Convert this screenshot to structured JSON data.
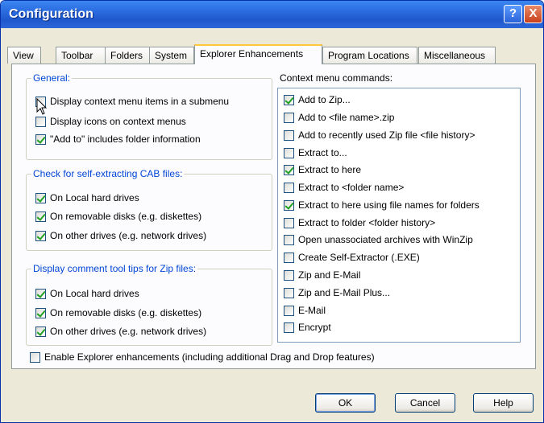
{
  "window": {
    "title": "Configuration"
  },
  "titlebar": {
    "help_glyph": "?",
    "close_glyph": "X"
  },
  "tabs": [
    {
      "label": "View"
    },
    {
      "label": "Toolbar"
    },
    {
      "label": "Folders"
    },
    {
      "label": "System"
    },
    {
      "label": "Explorer Enhancements"
    },
    {
      "label": "Program Locations"
    },
    {
      "label": "Miscellaneous"
    }
  ],
  "general": {
    "legend": "General:",
    "items": [
      {
        "label": "Display context menu items in a submenu",
        "checked": false
      },
      {
        "label": "Display icons on context menus",
        "checked": false
      },
      {
        "label": "\"Add to\" includes folder information",
        "checked": true
      }
    ]
  },
  "cab": {
    "legend": "Check for self-extracting CAB files:",
    "items": [
      {
        "label": "On Local hard drives",
        "checked": true
      },
      {
        "label": "On removable disks (e.g. diskettes)",
        "checked": true
      },
      {
        "label": "On other drives (e.g. network drives)",
        "checked": true
      }
    ]
  },
  "tooltips": {
    "legend": "Display comment tool tips for Zip files:",
    "items": [
      {
        "label": "On Local hard drives",
        "checked": true
      },
      {
        "label": "On removable disks (e.g. diskettes)",
        "checked": true
      },
      {
        "label": "On other drives (e.g. network drives)",
        "checked": true
      }
    ]
  },
  "context_menu": {
    "title": "Context menu commands:",
    "items": [
      {
        "label": "Add to Zip...",
        "checked": true
      },
      {
        "label": "Add to <file name>.zip",
        "checked": false
      },
      {
        "label": "Add to recently used Zip file <file history>",
        "checked": false
      },
      {
        "label": "Extract to...",
        "checked": false
      },
      {
        "label": "Extract to here",
        "checked": true
      },
      {
        "label": "Extract to <folder name>",
        "checked": false
      },
      {
        "label": "Extract to here using file names for folders",
        "checked": true
      },
      {
        "label": "Extract to folder <folder history>",
        "checked": false
      },
      {
        "label": "Open unassociated archives with WinZip",
        "checked": false
      },
      {
        "label": "Create Self-Extractor (.EXE)",
        "checked": false
      },
      {
        "label": "Zip and E-Mail",
        "checked": false
      },
      {
        "label": "Zip and E-Mail Plus...",
        "checked": false
      },
      {
        "label": "E-Mail",
        "checked": false
      },
      {
        "label": "Encrypt",
        "checked": false
      }
    ]
  },
  "enable_explorer": {
    "label": "Enable Explorer enhancements (including additional Drag and Drop features)",
    "checked": false
  },
  "buttons": {
    "ok": "OK",
    "cancel": "Cancel",
    "help": "Help"
  }
}
